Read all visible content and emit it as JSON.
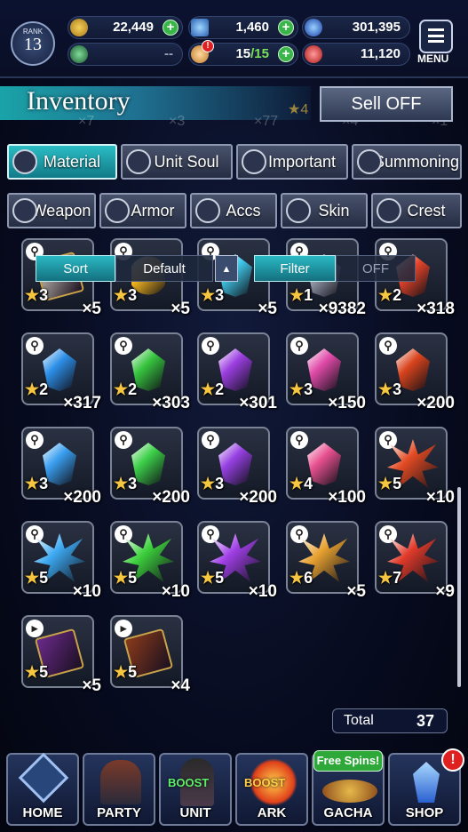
{
  "header": {
    "rank_label": "RANK",
    "rank_value": "13",
    "gil": "22,449",
    "lapis": "1,460",
    "stat3": "301,395",
    "stat4": "--",
    "stamina": "15",
    "stamina_max": "/15",
    "stat6": "11,120",
    "menu_label": "MENU"
  },
  "title": {
    "text": "Inventory",
    "sell_label": "Sell OFF",
    "ghost_texts": [
      "×7",
      "×3",
      "×77",
      "★4",
      "×4",
      "×1"
    ]
  },
  "tabs_row1": [
    {
      "label": "Material",
      "icon": "bag-icon",
      "selected": true
    },
    {
      "label": "Unit Soul",
      "icon": "soul-icon",
      "selected": false
    },
    {
      "label": "Important",
      "icon": "star-icon",
      "selected": false
    },
    {
      "label": "Summoning",
      "icon": "summon-icon",
      "selected": false
    }
  ],
  "tabs_row2": [
    {
      "label": "Weapon",
      "icon": "sword-icon"
    },
    {
      "label": "Armor",
      "icon": "armor-icon"
    },
    {
      "label": "Accs",
      "icon": "ring-icon"
    },
    {
      "label": "Skin",
      "icon": "hanger-icon"
    },
    {
      "label": "Crest",
      "icon": "crest-icon"
    }
  ],
  "sort": {
    "sort_label": "Sort",
    "sort_value": "Default",
    "filter_label": "Filter",
    "filter_value": "OFF"
  },
  "items": [
    {
      "stars": "3",
      "qty": "×5",
      "kind": "scroll",
      "color": "#d8d2c4"
    },
    {
      "stars": "3",
      "qty": "×5",
      "kind": "orb",
      "color": "#f2b41e"
    },
    {
      "stars": "3",
      "qty": "×5",
      "kind": "gem",
      "color": "#3fc7e8"
    },
    {
      "stars": "1",
      "qty": "×9382",
      "kind": "gem",
      "color": "#9aa0b0"
    },
    {
      "stars": "2",
      "qty": "×318",
      "kind": "gem",
      "color": "#e8452a"
    },
    {
      "stars": "2",
      "qty": "×317",
      "kind": "gem",
      "color": "#2d8fe8"
    },
    {
      "stars": "2",
      "qty": "×303",
      "kind": "gem",
      "color": "#36c43e"
    },
    {
      "stars": "2",
      "qty": "×301",
      "kind": "gem",
      "color": "#9b3ee0"
    },
    {
      "stars": "3",
      "qty": "×150",
      "kind": "gem",
      "color": "#e04aa8"
    },
    {
      "stars": "3",
      "qty": "×200",
      "kind": "gem",
      "color": "#d8431c"
    },
    {
      "stars": "3",
      "qty": "×200",
      "kind": "gem",
      "color": "#3a9ff0"
    },
    {
      "stars": "3",
      "qty": "×200",
      "kind": "gem",
      "color": "#3ccf48"
    },
    {
      "stars": "3",
      "qty": "×200",
      "kind": "gem",
      "color": "#9640e2"
    },
    {
      "stars": "4",
      "qty": "×100",
      "kind": "gem",
      "color": "#e85090"
    },
    {
      "stars": "5",
      "qty": "×10",
      "kind": "burst",
      "color": "#e24a22"
    },
    {
      "stars": "5",
      "qty": "×10",
      "kind": "burst",
      "color": "#3ca8f0"
    },
    {
      "stars": "5",
      "qty": "×10",
      "kind": "burst",
      "color": "#3ccf3c"
    },
    {
      "stars": "5",
      "qty": "×10",
      "kind": "burst",
      "color": "#a03fe6"
    },
    {
      "stars": "6",
      "qty": "×5",
      "kind": "burst",
      "color": "#e6a030"
    },
    {
      "stars": "7",
      "qty": "×9",
      "kind": "burst",
      "color": "#e03a2a"
    },
    {
      "stars": "5",
      "qty": "×5",
      "kind": "book",
      "color": "#6a2a8a"
    },
    {
      "stars": "5",
      "qty": "×4",
      "kind": "book",
      "color": "#8a3a1a"
    }
  ],
  "total": {
    "label": "Total",
    "value": "37"
  },
  "nav": [
    {
      "label": "HOME",
      "icon": "home-icon"
    },
    {
      "label": "PARTY",
      "icon": "party-icon"
    },
    {
      "label": "UNIT",
      "icon": "unit-icon",
      "badge": "BOOST"
    },
    {
      "label": "ARK",
      "icon": "ark-icon",
      "badge": "BOOST"
    },
    {
      "label": "GACHA",
      "icon": "gacha-icon"
    },
    {
      "label": "SHOP",
      "icon": "shop-icon"
    }
  ],
  "gacha_banner": "Free Spins!",
  "shop_alert": "!",
  "stamina_alert": "!"
}
